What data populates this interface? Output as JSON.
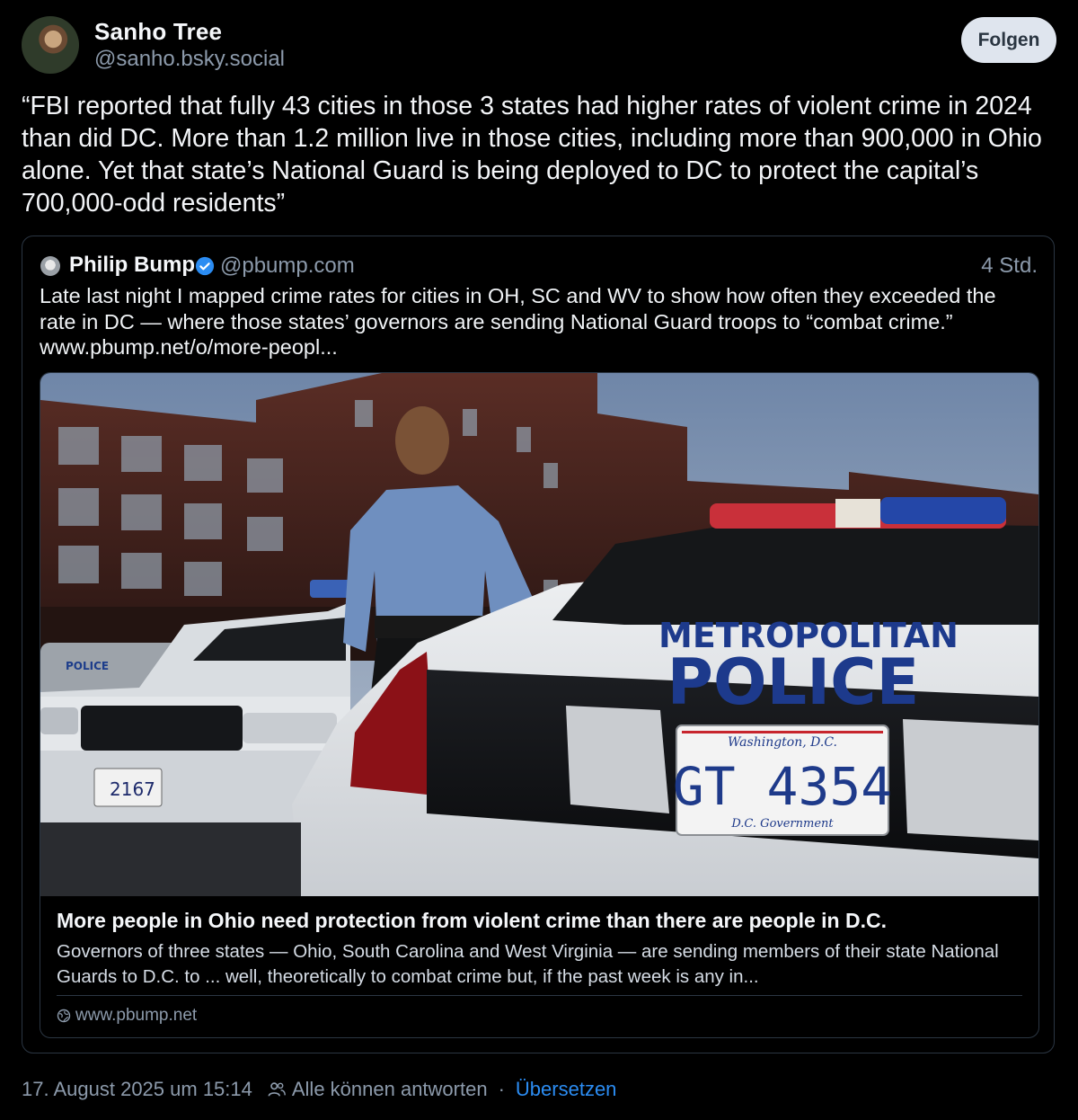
{
  "post": {
    "author_name": "Sanho Tree",
    "author_handle": "@sanho.bsky.social",
    "follow_label": "Folgen",
    "text": "“FBI reported that fully 43 cities in those 3 states had higher rates of violent crime in 2024 than did DC. More than 1.2 million live in those cities, including more than 900,000 in Ohio alone. Yet that state’s National Guard is being deployed to DC to protect the capital’s 700,000-odd residents”"
  },
  "quote": {
    "author_name": "Philip Bump",
    "author_handle": "@pbump.com",
    "time": "4 Std.",
    "text": "Late last night I mapped crime rates for cities in OH, SC and WV to show how often they exceeded the rate in DC — where those states’ governors are sending National Guard troops to “combat crime.” www.pbump.net/o/more-peopl..."
  },
  "embed": {
    "car_text_line1": "METROPOLITAN",
    "car_text_line2": "POLICE",
    "plate_top": "Washington, D.C.",
    "plate_number": "GT 4354",
    "plate_bottom": "D.C. Government",
    "left_plate_number": "2167",
    "left_car_text": "POLICE",
    "title": "More people in Ohio need protection from violent crime than there are people in D.C.",
    "description": "Governors of three states — Ohio, South Carolina and West Virginia — are sending members of their state National Guards to D.C. to ... well, theoretically to combat crime but, if the past week is any in...",
    "domain": "www.pbump.net"
  },
  "footer": {
    "date": "17. August 2025 um 15:14",
    "reply_setting": "Alle können antworten",
    "separator": "·",
    "translate_label": "Übersetzen"
  },
  "colors": {
    "background": "#000000",
    "border": "#2b3643",
    "muted_text": "#8c9aab",
    "link": "#2b8cf2",
    "verified": "#2b8cf2",
    "follow_button_bg": "#dfe5ee"
  },
  "icons": [
    "verified-badge-icon",
    "globe-icon",
    "people-icon"
  ]
}
